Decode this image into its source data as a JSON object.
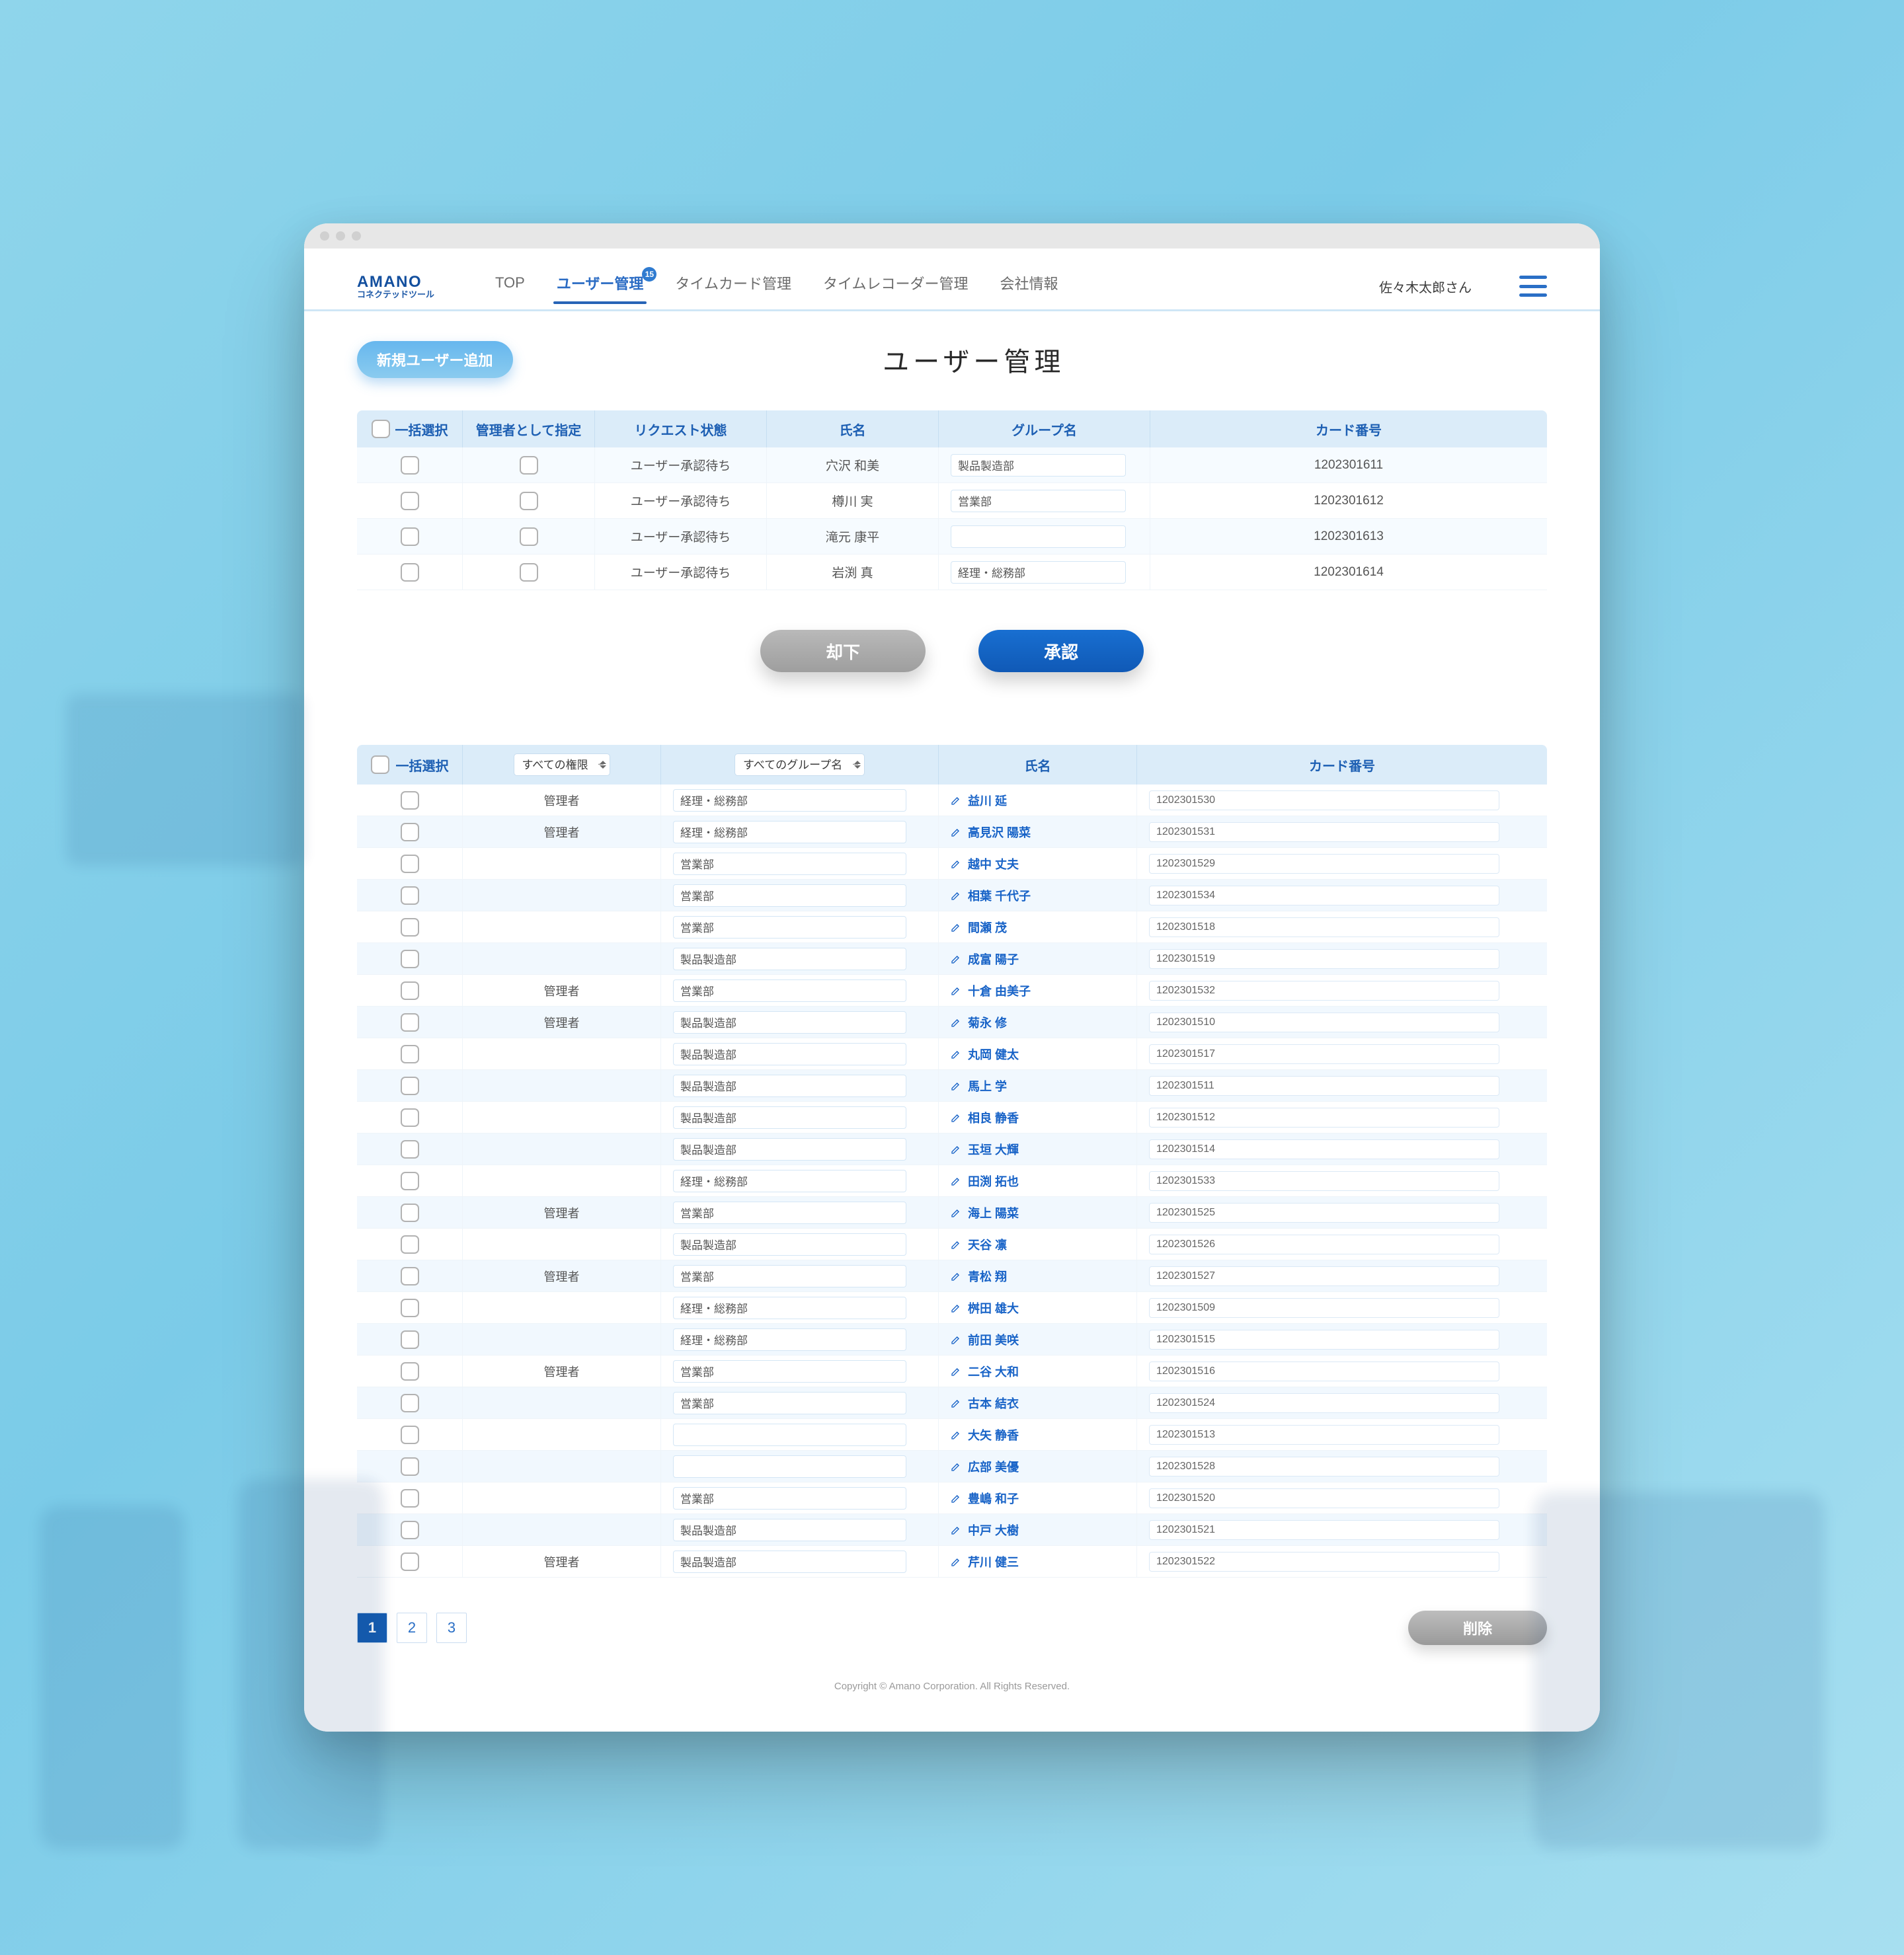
{
  "brand": {
    "name": "AMANO",
    "sub": "コネクテッドツール"
  },
  "nav": {
    "items": [
      {
        "label": "TOP"
      },
      {
        "label": "ユーザー管理",
        "active": true,
        "badge": "15"
      },
      {
        "label": "タイムカード管理"
      },
      {
        "label": "タイムレコーダー管理"
      },
      {
        "label": "会社情報"
      }
    ]
  },
  "user": {
    "name": "佐々木太郎さん"
  },
  "buttons": {
    "new_user": "新規ユーザー追加",
    "reject": "却下",
    "approve": "承認",
    "delete": "削除"
  },
  "page_title": "ユーザー管理",
  "table1": {
    "headers": {
      "bulk": "一括選択",
      "as_admin": "管理者として指定",
      "status": "リクエスト状態",
      "name": "氏名",
      "group": "グループ名",
      "card": "カード番号"
    },
    "rows": [
      {
        "status": "ユーザー承認待ち",
        "name": "穴沢 和美",
        "group": "製品製造部",
        "card": "1202301611"
      },
      {
        "status": "ユーザー承認待ち",
        "name": "樽川 実",
        "group": "営業部",
        "card": "1202301612"
      },
      {
        "status": "ユーザー承認待ち",
        "name": "滝元 康平",
        "group": "",
        "card": "1202301613"
      },
      {
        "status": "ユーザー承認待ち",
        "name": "岩渕 真",
        "group": "経理・総務部",
        "card": "1202301614"
      }
    ]
  },
  "table2": {
    "headers": {
      "bulk": "一括選択",
      "role_select": "すべての権限",
      "group_select": "すべてのグループ名",
      "name": "氏名",
      "card": "カード番号"
    },
    "rows": [
      {
        "role": "管理者",
        "group": "経理・総務部",
        "name": "益川 延",
        "card": "1202301530"
      },
      {
        "role": "管理者",
        "group": "経理・総務部",
        "name": "高見沢 陽菜",
        "card": "1202301531"
      },
      {
        "role": "",
        "group": "営業部",
        "name": "越中 丈夫",
        "card": "1202301529"
      },
      {
        "role": "",
        "group": "営業部",
        "name": "相葉 千代子",
        "card": "1202301534"
      },
      {
        "role": "",
        "group": "営業部",
        "name": "間瀬 茂",
        "card": "1202301518"
      },
      {
        "role": "",
        "group": "製品製造部",
        "name": "成富 陽子",
        "card": "1202301519"
      },
      {
        "role": "管理者",
        "group": "営業部",
        "name": "十倉 由美子",
        "card": "1202301532"
      },
      {
        "role": "管理者",
        "group": "製品製造部",
        "name": "菊永 修",
        "card": "1202301510"
      },
      {
        "role": "",
        "group": "製品製造部",
        "name": "丸岡 健太",
        "card": "1202301517"
      },
      {
        "role": "",
        "group": "製品製造部",
        "name": "馬上 学",
        "card": "1202301511"
      },
      {
        "role": "",
        "group": "製品製造部",
        "name": "相良 静香",
        "card": "1202301512"
      },
      {
        "role": "",
        "group": "製品製造部",
        "name": "玉垣 大輝",
        "card": "1202301514"
      },
      {
        "role": "",
        "group": "経理・総務部",
        "name": "田渕 拓也",
        "card": "1202301533"
      },
      {
        "role": "管理者",
        "group": "営業部",
        "name": "海上 陽菜",
        "card": "1202301525"
      },
      {
        "role": "",
        "group": "製品製造部",
        "name": "天谷 凛",
        "card": "1202301526"
      },
      {
        "role": "管理者",
        "group": "営業部",
        "name": "青松 翔",
        "card": "1202301527"
      },
      {
        "role": "",
        "group": "経理・総務部",
        "name": "桝田 雄大",
        "card": "1202301509"
      },
      {
        "role": "",
        "group": "経理・総務部",
        "name": "前田 美咲",
        "card": "1202301515"
      },
      {
        "role": "管理者",
        "group": "営業部",
        "name": "二谷 大和",
        "card": "1202301516"
      },
      {
        "role": "",
        "group": "営業部",
        "name": "古本 結衣",
        "card": "1202301524"
      },
      {
        "role": "",
        "group": "",
        "name": "大矢 静香",
        "card": "1202301513"
      },
      {
        "role": "",
        "group": "",
        "name": "広部 美優",
        "card": "1202301528"
      },
      {
        "role": "",
        "group": "営業部",
        "name": "豊嶋 和子",
        "card": "1202301520"
      },
      {
        "role": "",
        "group": "製品製造部",
        "name": "中戸 大樹",
        "card": "1202301521"
      },
      {
        "role": "管理者",
        "group": "製品製造部",
        "name": "芹川 健三",
        "card": "1202301522"
      }
    ]
  },
  "pager": {
    "pages": [
      "1",
      "2",
      "3"
    ],
    "current": 1
  },
  "footer": "Copyright © Amano Corporation. All Rights Reserved."
}
